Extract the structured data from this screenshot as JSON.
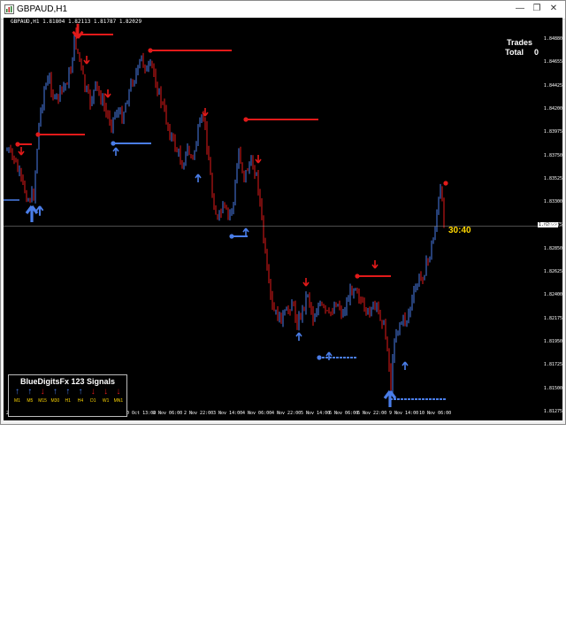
{
  "window": {
    "title": "GBPAUD,H1",
    "buttons": [
      "—",
      "❐",
      "✕"
    ]
  },
  "chart": {
    "info_line": "GBPAUD,H1  1.81804 1.82113 1.81787 1.82029",
    "trades_label": "Trades",
    "total_label": "Total",
    "total_value": "0",
    "timer": "30:40",
    "current_price": "1.82029",
    "price_axis": [
      "1.84880",
      "1.84655",
      "1.84425",
      "1.84200",
      "1.83975",
      "1.83750",
      "1.83525",
      "1.83300",
      "1.83075",
      "1.82850",
      "1.82625",
      "1.82400",
      "1.82175",
      "1.81950",
      "1.81725",
      "1.81500",
      "1.81275",
      "1.81050",
      "1.80825",
      "1.80600",
      "1.80375",
      "1.80145",
      "1.79920",
      "1.79695",
      "1.79470",
      "1.79245"
    ],
    "time_axis": [
      "27 Oct 2020",
      "28 Oct 13:00",
      "29 Oct 05:00",
      "29 Oct 21:00",
      "30 Oct 13:00",
      "2 Nov 06:00",
      "2 Nov 22:00",
      "3 Nov 14:00",
      "4 Nov 06:00",
      "4 Nov 22:00",
      "5 Nov 14:00",
      "6 Nov 06:00",
      "6 Nov 22:00",
      "9 Nov 14:00",
      "10 Nov 06:00"
    ],
    "colors": {
      "background": "#000000",
      "bull": "#4a7de8",
      "bear": "#e21a1a",
      "text": "#ffffff",
      "accent": "#ffd700"
    }
  },
  "panel": {
    "title": "BlueDigitsFx 123 Signals",
    "signals": [
      {
        "tf": "M1",
        "dir": "up",
        "icon": "arrow-up-icon"
      },
      {
        "tf": "M5",
        "dir": "up",
        "icon": "arrow-up-icon"
      },
      {
        "tf": "M15",
        "dir": "down",
        "icon": "arrow-down-icon"
      },
      {
        "tf": "M30",
        "dir": "up",
        "icon": "arrow-up-icon"
      },
      {
        "tf": "H1",
        "dir": "up",
        "icon": "arrow-up-icon"
      },
      {
        "tf": "H4",
        "dir": "up",
        "icon": "arrow-up-icon"
      },
      {
        "tf": "D1",
        "dir": "down",
        "icon": "arrow-down-icon"
      },
      {
        "tf": "W1",
        "dir": "down",
        "icon": "arrow-down-icon"
      },
      {
        "tf": "MN1",
        "dir": "down",
        "icon": "arrow-down-icon"
      }
    ]
  }
}
